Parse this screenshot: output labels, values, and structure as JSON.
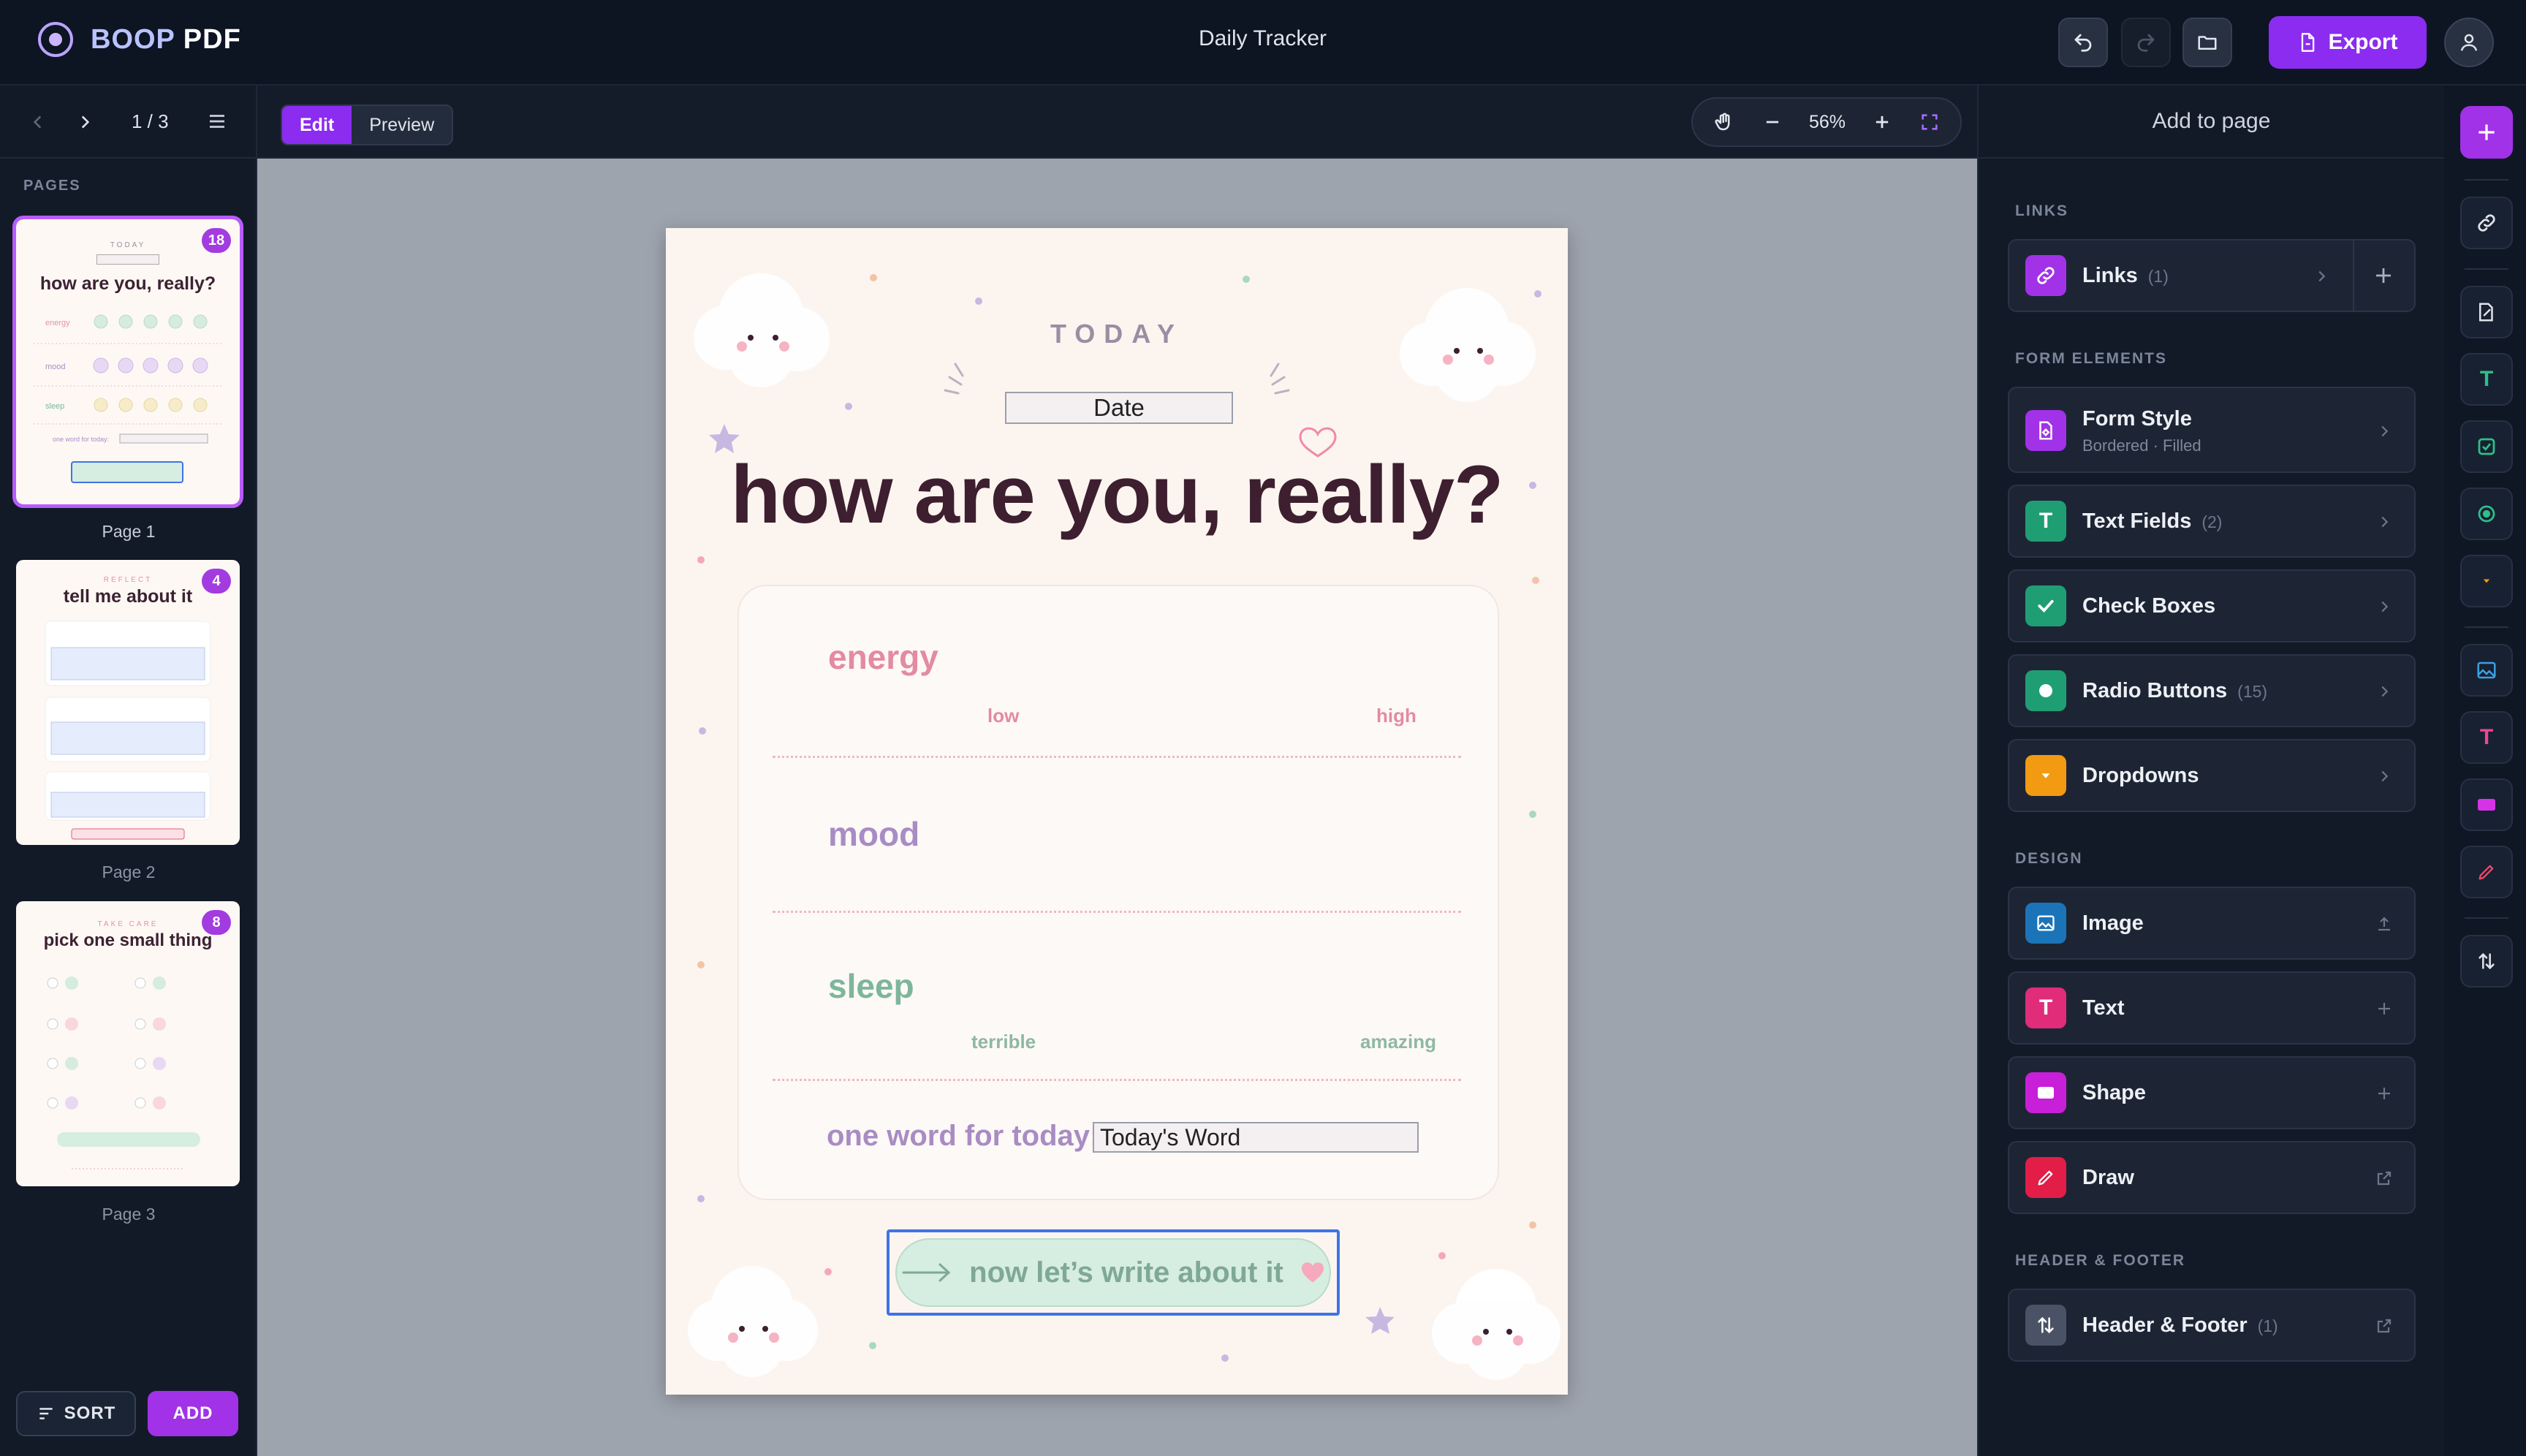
{
  "app": {
    "logo_part1": "BOOP",
    "logo_part2": "PDF",
    "doc_title": "Daily Tracker",
    "export_label": "Export"
  },
  "left": {
    "page_indicator": "1 / 3",
    "pages_label": "PAGES",
    "pages": [
      {
        "label": "Page 1",
        "badge": "18",
        "title": "how are you, really?",
        "kicker": "TODAY"
      },
      {
        "label": "Page 2",
        "badge": "4",
        "title": "tell me about it",
        "kicker": "REFLECT"
      },
      {
        "label": "Page 3",
        "badge": "8",
        "title": "pick one small thing",
        "kicker": "TAKE CARE"
      }
    ],
    "sort_label": "SORT",
    "add_label": "ADD"
  },
  "canvas": {
    "mode_edit": "Edit",
    "mode_preview": "Preview",
    "zoom_value": "56%"
  },
  "page": {
    "kicker": "TODAY",
    "date_value": "Date",
    "title": "how are you, really?",
    "energy_label": "energy",
    "energy_low": "low",
    "energy_high": "high",
    "mood_label": "mood",
    "sleep_label": "sleep",
    "sleep_low": "terrible",
    "sleep_high": "amazing",
    "word_label": "one word for today:",
    "word_value": "Today's Word",
    "cta_label": "now let’s write about it",
    "colors": {
      "energy": "#d5ecdf",
      "mood": "#e7d9f3",
      "sleep": "#f6ecc9",
      "title": "#3d1f30"
    }
  },
  "right": {
    "head": "Add to page",
    "sec_links": "LINKS",
    "sec_form": "FORM ELEMENTS",
    "sec_design": "DESIGN",
    "sec_hf": "HEADER & FOOTER",
    "links": {
      "name": "Links",
      "count": "(1)"
    },
    "form_style": {
      "name": "Form Style",
      "sub": "Bordered · Filled"
    },
    "text_fields": {
      "name": "Text Fields",
      "count": "(2)"
    },
    "check_boxes": {
      "name": "Check Boxes"
    },
    "radio_buttons": {
      "name": "Radio Buttons",
      "count": "(15)"
    },
    "dropdowns": {
      "name": "Dropdowns"
    },
    "image": {
      "name": "Image"
    },
    "text": {
      "name": "Text"
    },
    "shape": {
      "name": "Shape"
    },
    "draw": {
      "name": "Draw"
    },
    "header_footer": {
      "name": "Header & Footer",
      "count": "(1)"
    }
  },
  "accent": "#8b2cf0"
}
